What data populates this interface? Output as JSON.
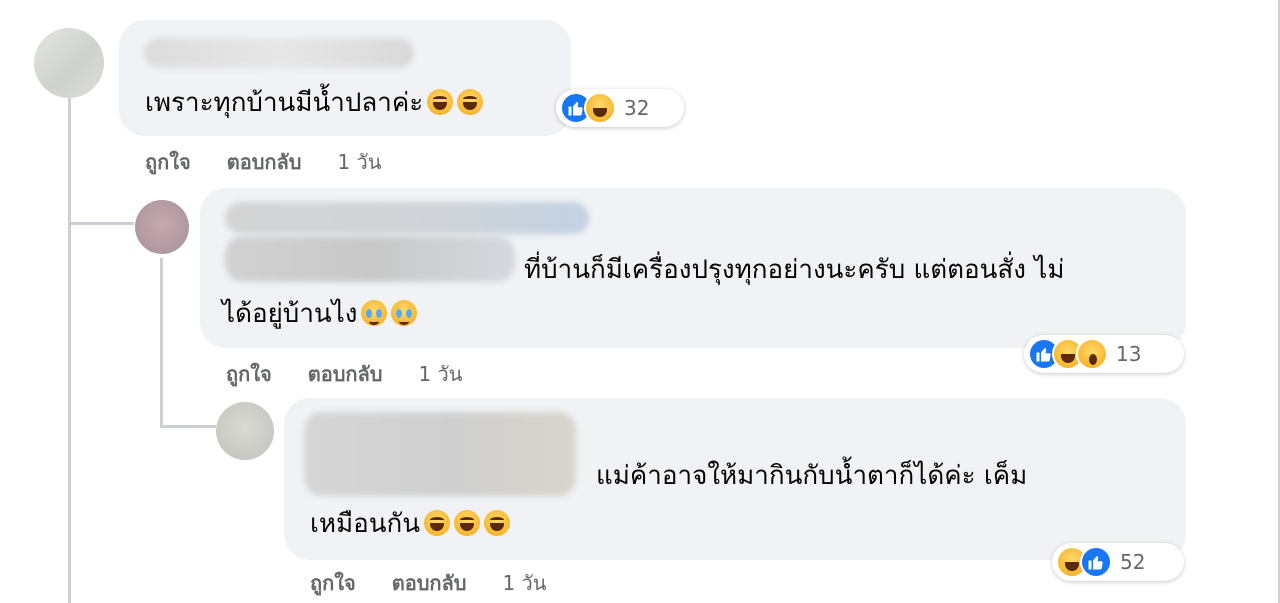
{
  "comments": [
    {
      "text": "เพราะทุกบ้านมีน้ำปลาค่ะ",
      "emojis": [
        "laugh",
        "laugh"
      ],
      "reactions": {
        "icons": [
          "like-icon",
          "haha-icon"
        ],
        "count": "32"
      },
      "actions": {
        "like": "ถูกใจ",
        "reply": "ตอบกลับ",
        "time": "1 วัน"
      }
    },
    {
      "text_line1": "ที่บ้านก็มีเครื่องปรุงทุกอย่างนะครับ แต่ตอนสั่ง ไม่",
      "text_line2": "ได้อยู่บ้านไง",
      "emojis": [
        "cry",
        "cry"
      ],
      "reactions": {
        "icons": [
          "like-icon",
          "haha-icon",
          "wow-icon"
        ],
        "count": "13"
      },
      "actions": {
        "like": "ถูกใจ",
        "reply": "ตอบกลับ",
        "time": "1 วัน"
      }
    },
    {
      "text_line1": "แม่ค้าอาจให้มากินกับน้ำตาก็ได้ค่ะ เค็ม",
      "text_line2": "เหมือนกัน",
      "emojis": [
        "laugh",
        "laugh",
        "laugh"
      ],
      "reactions": {
        "icons": [
          "haha-icon",
          "like-icon"
        ],
        "count": "52"
      },
      "actions": {
        "like": "ถูกใจ",
        "reply": "ตอบกลับ",
        "time": "1 วัน"
      }
    }
  ],
  "colors": {
    "bubble": "#f0f2f5",
    "like_blue": "#1877f2",
    "meta_gray": "#65676b"
  }
}
